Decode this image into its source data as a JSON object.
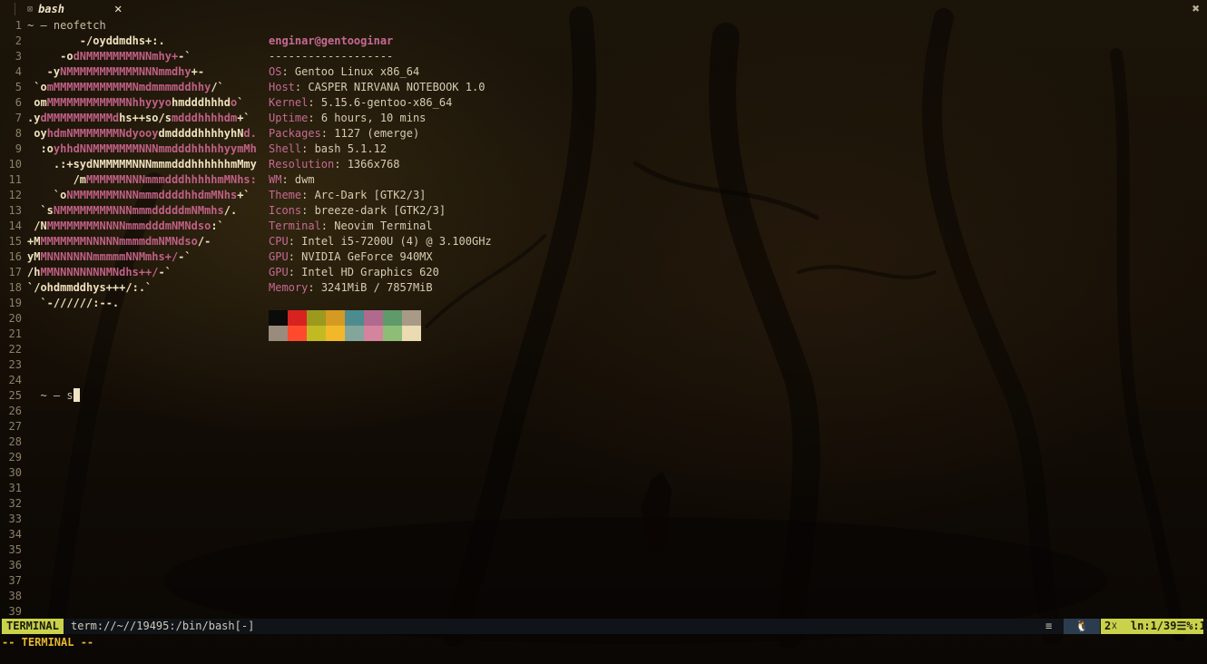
{
  "tab": {
    "title": "bash",
    "marker": "⊠",
    "close": "✕"
  },
  "window_close": "✖",
  "line_numbers": [
    "1",
    "2",
    "3",
    "4",
    "5",
    "6",
    "7",
    "8",
    "9",
    "10",
    "11",
    "12",
    "13",
    "14",
    "15",
    "16",
    "17",
    "18",
    "19",
    "20",
    "21",
    "22",
    "23",
    "24",
    "25",
    "26",
    "27",
    "28",
    "29",
    "30",
    "31",
    "32",
    "33",
    "34",
    "35",
    "36",
    "37",
    "38",
    "39"
  ],
  "lines": {
    "first_prompt": "~ – neofetch",
    "second_prompt": "~ – s"
  },
  "logo": [
    [
      [
        "w",
        "        -/oyddmdhs+:."
      ]
    ],
    [
      [
        "w",
        "     -o"
      ],
      [
        "p",
        "dNMMMMMMMMNNmhy+"
      ],
      [
        "w",
        "-`"
      ]
    ],
    [
      [
        "w",
        "   -y"
      ],
      [
        "p",
        "NMMMMMMMMMMMNNNmmdhy"
      ],
      [
        "w",
        "+-"
      ]
    ],
    [
      [
        "w",
        " `o"
      ],
      [
        "p",
        "mMMMMMMMMMMMMNmdmmmmddhhy"
      ],
      [
        "w",
        "/`"
      ]
    ],
    [
      [
        "w",
        " om"
      ],
      [
        "p",
        "MMMMMMMMMMMMNhhyyyo"
      ],
      [
        "w",
        "hmdddhhhd"
      ],
      [
        "p",
        "o"
      ],
      [
        "w",
        "`"
      ]
    ],
    [
      [
        "w",
        ".y"
      ],
      [
        "p",
        "dMMMMMMMMMMd"
      ],
      [
        "w",
        "hs++so/s"
      ],
      [
        "p",
        "mdddhhhhdm"
      ],
      [
        "w",
        "+`"
      ]
    ],
    [
      [
        "w",
        " oy"
      ],
      [
        "p",
        "hdmNMMMMMMMNdyooy"
      ],
      [
        "w",
        "dmddddhhhhyhN"
      ],
      [
        "p",
        "d."
      ]
    ],
    [
      [
        "w",
        "  :o"
      ],
      [
        "p",
        "yhhdNNMMMMMMMNNNmmdddhhhhhyymMh"
      ]
    ],
    [
      [
        "w",
        "    .:+sydNMMMMMNNNmmmdddhhhhhhmMmy"
      ]
    ],
    [
      [
        "w",
        "       /m"
      ],
      [
        "p",
        "MMMMMMNNNmmmdddhhhhhmMNhs:"
      ]
    ],
    [
      [
        "w",
        "    `o"
      ],
      [
        "p",
        "NMMMMMMMNNNmmmddddhhdmMNhs"
      ],
      [
        "w",
        "+`"
      ]
    ],
    [
      [
        "w",
        "  `s"
      ],
      [
        "p",
        "NMMMMMMMMNNNmmmdddddmNMmhs"
      ],
      [
        "w",
        "/."
      ]
    ],
    [
      [
        "w",
        " /N"
      ],
      [
        "p",
        "MMMMMMMMNNNNmmmdddmNMNdso"
      ],
      [
        "w",
        ":`"
      ]
    ],
    [
      [
        "w",
        "+M"
      ],
      [
        "p",
        "MMMMMMMNNNNNmmmmdmNMNdso"
      ],
      [
        "w",
        "/-"
      ]
    ],
    [
      [
        "w",
        "yM"
      ],
      [
        "p",
        "MNNNNNNNmmmmmNNMmhs+/"
      ],
      [
        "w",
        "-`"
      ]
    ],
    [
      [
        "w",
        "/h"
      ],
      [
        "p",
        "MMNNNNNNNNMNdhs++/"
      ],
      [
        "w",
        "-`"
      ]
    ],
    [
      [
        "w",
        "`/ohdmmddhys+++/:.`"
      ]
    ],
    [
      [
        "w",
        "  `-//////:--."
      ]
    ]
  ],
  "info": {
    "user_host": "enginar@gentooginar",
    "separator": "-------------------",
    "rows": [
      {
        "key": "OS",
        "value": "Gentoo Linux x86_64"
      },
      {
        "key": "Host",
        "value": "CASPER NIRVANA NOTEBOOK 1.0"
      },
      {
        "key": "Kernel",
        "value": "5.15.6-gentoo-x86_64"
      },
      {
        "key": "Uptime",
        "value": "6 hours, 10 mins"
      },
      {
        "key": "Packages",
        "value": "1127 (emerge)"
      },
      {
        "key": "Shell",
        "value": "bash 5.1.12"
      },
      {
        "key": "Resolution",
        "value": "1366x768"
      },
      {
        "key": "WM",
        "value": "dwm"
      },
      {
        "key": "Theme",
        "value": "Arc-Dark [GTK2/3]"
      },
      {
        "key": "Icons",
        "value": "breeze-dark [GTK2/3]"
      },
      {
        "key": "Terminal",
        "value": "Neovim Terminal"
      },
      {
        "key": "CPU",
        "value": "Intel i5-7200U (4) @ 3.100GHz"
      },
      {
        "key": "GPU",
        "value": "NVIDIA GeForce 940MX"
      },
      {
        "key": "GPU",
        "value": "Intel HD Graphics 620"
      },
      {
        "key": "Memory",
        "value": "3241MiB / 7857MiB"
      }
    ]
  },
  "palette": {
    "row1": [
      "#0b0b0b",
      "#d7231f",
      "#9c9a1e",
      "#d49a22",
      "#4c8c8e",
      "#b06a8e",
      "#5f9a6a",
      "#a89a86"
    ],
    "row2": [
      "#9a8c7c",
      "#ff4a2e",
      "#c2ba22",
      "#f2b82a",
      "#83a59c",
      "#d4849c",
      "#8ebd78",
      "#ebdbb2"
    ]
  },
  "statusline": {
    "mode": "TERMINAL",
    "filename": "term://~//19495:/bin/bash[-]",
    "filetype_icon": "≡",
    "os_icon": "🐧",
    "position": "2☓  ln:1/39☰%:1"
  },
  "cmdline": "-- TERMINAL --",
  "colors": {
    "accent": "#c9d24a",
    "key_pink": "#c66a93",
    "mode_text": "#e6b830"
  }
}
